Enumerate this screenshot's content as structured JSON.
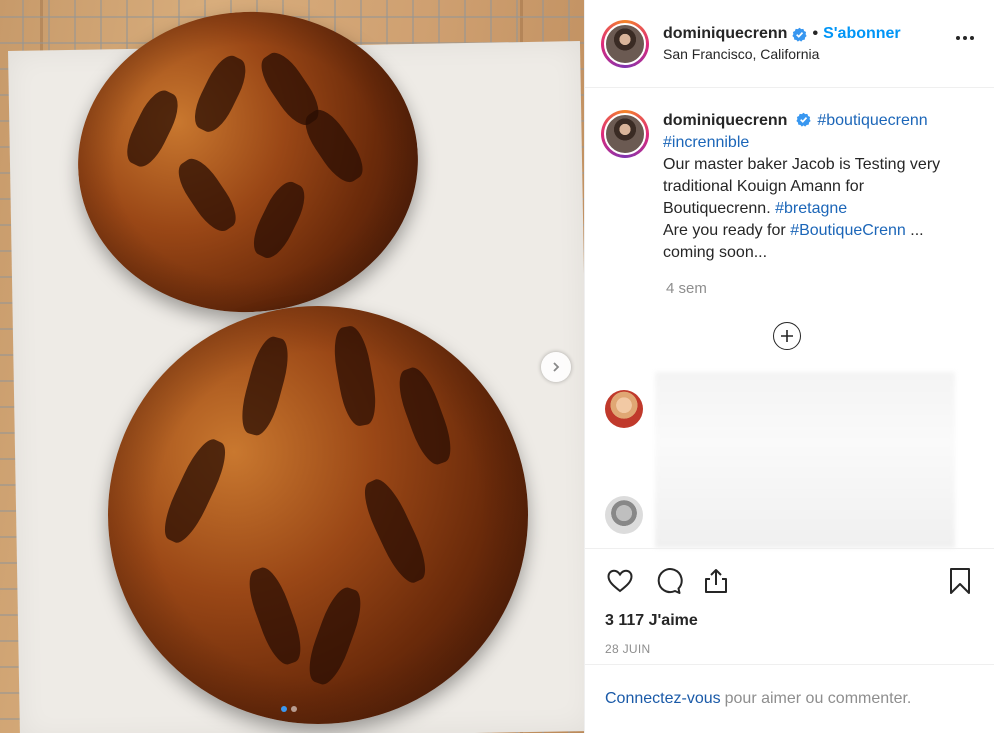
{
  "post": {
    "username": "dominiquecrenn",
    "follow_label": "S'abonner",
    "separator": "•",
    "location": "San Francisco, California",
    "caption": {
      "tag_boutique": "#boutiquecrenn",
      "tag_incrennible": "#incrennible",
      "text1": "Our master baker Jacob is Testing very traditional Kouign Amann for Boutiquecrenn.",
      "tag_bretagne": "#bretagne",
      "text2": "Are you ready for",
      "tag_boutique2": "#BoutiqueCrenn",
      "text3": "... coming soon..."
    },
    "time_ago": "4 sem",
    "likes": "3 117 J'aime",
    "date": "28 JUIN"
  },
  "login": {
    "link": "Connectez-vous",
    "rest": "pour aimer ou commenter."
  },
  "icons": {
    "verified": "verified-badge-icon",
    "more": "more-options-icon",
    "like": "heart-icon",
    "comment": "comment-bubble-icon",
    "share": "share-icon",
    "save": "bookmark-icon",
    "load_more": "plus-circle-icon",
    "next": "chevron-right-icon"
  },
  "colors": {
    "accent": "#0095f6",
    "hashtag": "#1c66b8",
    "muted": "#8e8e8e",
    "text": "#262626"
  }
}
